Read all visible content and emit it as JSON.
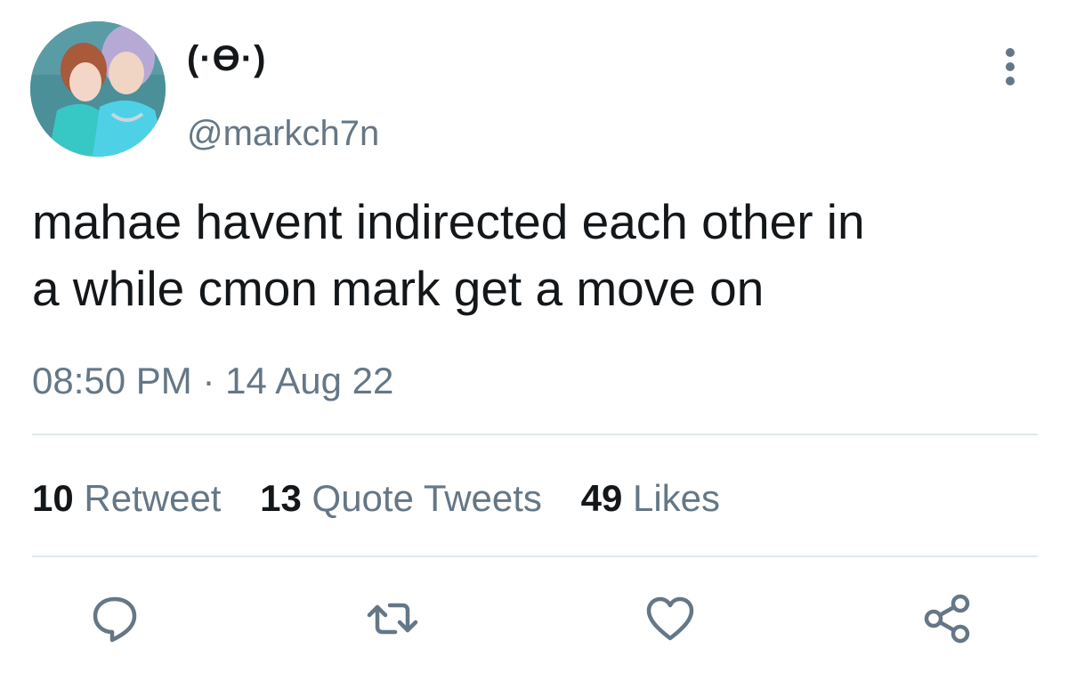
{
  "user": {
    "display_name": "(·ϴ·)",
    "handle": "@markch7n"
  },
  "tweet": {
    "text": "mahae havent indirected each other in\na while cmon mark get a move on",
    "time": "08:50 PM",
    "separator": "·",
    "date": "14 Aug 22"
  },
  "stats": {
    "retweets": {
      "count": "10",
      "label": "Retweet"
    },
    "quotes": {
      "count": "13",
      "label": "Quote Tweets"
    },
    "likes": {
      "count": "49",
      "label": "Likes"
    }
  },
  "actions": [
    {
      "icon": "reply-icon"
    },
    {
      "icon": "retweet-icon"
    },
    {
      "icon": "like-icon"
    },
    {
      "icon": "share-icon"
    }
  ],
  "colors": {
    "text": "#14171a",
    "secondary": "#657786",
    "divider": "#e1e8ed"
  }
}
